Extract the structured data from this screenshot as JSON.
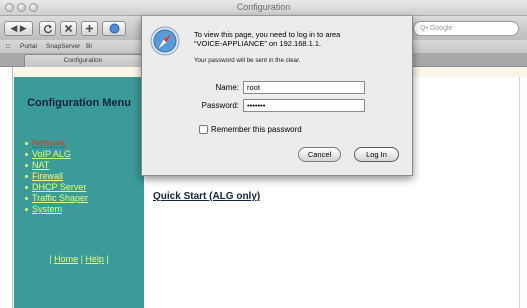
{
  "window": {
    "title": "Configuration"
  },
  "toolbar": {
    "back_fwd": "◀ ▶",
    "refresh_icon": "refresh-icon",
    "stop_icon": "stop-icon",
    "add_icon": "plus-icon",
    "search_placeholder": "Q• Google"
  },
  "bookmarks": {
    "items": [
      "□",
      "Portal",
      "SnapServer",
      "Bi"
    ]
  },
  "tab": {
    "label": "Configuration"
  },
  "sidebar": {
    "title": "Configuration Menu",
    "items": [
      "Network",
      "VoIP ALG",
      "NAT",
      "Firewall",
      "DHCP Server",
      "Traffic Shaper",
      "System"
    ],
    "footer": {
      "home": "Home",
      "help": "Help"
    },
    "colors": {
      "bg": "#3a9b98",
      "link": "#e7ff75",
      "active": "#d93b1c",
      "title": "#10253b"
    }
  },
  "main": {
    "links": [
      "Quick Start (ALG only)"
    ]
  },
  "auth_dialog": {
    "message_line1": "To view this page, you need to log in to area",
    "message_line2": "“VOICE-APPLIANCE” on 192.168.1.1.",
    "note": "Your password will be sent in the clear.",
    "name_label": "Name:",
    "name_value": "root",
    "password_label": "Password:",
    "password_value": "•••••••",
    "remember_label": "Remember this password",
    "cancel_label": "Cancel",
    "login_label": "Log In"
  }
}
